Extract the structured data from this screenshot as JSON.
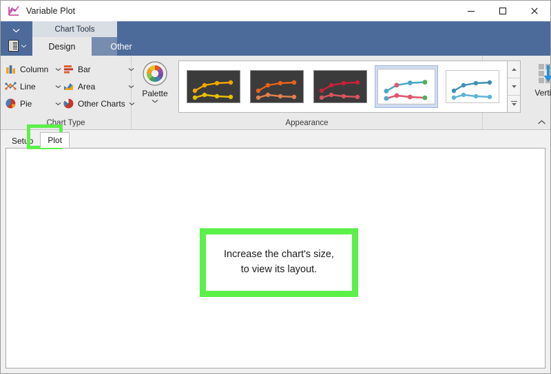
{
  "window": {
    "title": "Variable Plot",
    "icon": "variable-plot-icon",
    "controls": {
      "minimize": "minimize-icon",
      "maximize": "maximize-icon",
      "close": "close-icon"
    }
  },
  "quick_access": {
    "customize_icon": "chevron-down-icon",
    "document_icon": "document-list-icon",
    "document_chevron": "chevron-down-icon"
  },
  "ribbon": {
    "contextual_label": "Chart Tools",
    "tabs": [
      {
        "label": "Design",
        "active": true
      },
      {
        "label": "Other",
        "active": false
      }
    ],
    "collapse_icon": "chevron-up-icon",
    "groups": [
      {
        "label": "Chart Type",
        "items": [
          {
            "label": "Column",
            "icon": "column-chart-icon",
            "chevron": "chevron-down-icon"
          },
          {
            "label": "Bar",
            "icon": "bar-chart-icon",
            "chevron": "chevron-down-icon"
          },
          {
            "label": "Line",
            "icon": "line-chart-icon",
            "chevron": "chevron-down-icon"
          },
          {
            "label": "Area",
            "icon": "area-chart-icon",
            "chevron": "chevron-down-icon"
          },
          {
            "label": "Pie",
            "icon": "pie-chart-icon",
            "chevron": "chevron-down-icon"
          },
          {
            "label": "Other Charts",
            "icon": "other-charts-icon",
            "chevron": "chevron-down-icon"
          }
        ]
      },
      {
        "label": "Appearance",
        "palette": {
          "label": "Palette",
          "icon": "color-wheel-icon",
          "chevron": "chevron-down-icon"
        },
        "gallery": {
          "scroll_up_icon": "scroll-up-icon",
          "scroll_down_icon": "scroll-down-icon",
          "more_icon": "gallery-more-icon",
          "styles": [
            {
              "name": "style-amber-dark",
              "background": "#3b3b3b",
              "series1": "#f0a800",
              "series2": "#e8b400",
              "selected": false
            },
            {
              "name": "style-orange-dark",
              "background": "#3b3b3b",
              "series1": "#e8621a",
              "series2": "#e08050",
              "selected": false
            },
            {
              "name": "style-red-dark",
              "background": "#3b3b3b",
              "series1": "#c9203a",
              "series2": "#d9545f",
              "selected": false
            },
            {
              "name": "style-blue-green-light",
              "background": "#ffffff",
              "series1": "#4aa8c8",
              "series2": "#e0576e",
              "selected": true
            },
            {
              "name": "style-blue-light",
              "background": "#ffffff",
              "series1": "#3d8fb5",
              "series2": "#5cb3d4",
              "selected": false
            }
          ]
        },
        "orientation": {
          "label": "Vertical",
          "icon": "vertical-orientation-icon"
        }
      }
    ]
  },
  "document_tabs": [
    {
      "label": "Setup",
      "active": false,
      "highlighted": false
    },
    {
      "label": "Plot",
      "active": true,
      "highlighted": true
    }
  ],
  "plot": {
    "message": "Increase the chart's size,\nto view its layout."
  },
  "colors": {
    "ribbon_blue": "#4c6b9a",
    "ribbon_face": "#e9e9e9",
    "highlight_green": "#5bf04a",
    "window_face": "#f0f0f0",
    "canvas_white": "#ffffff"
  }
}
